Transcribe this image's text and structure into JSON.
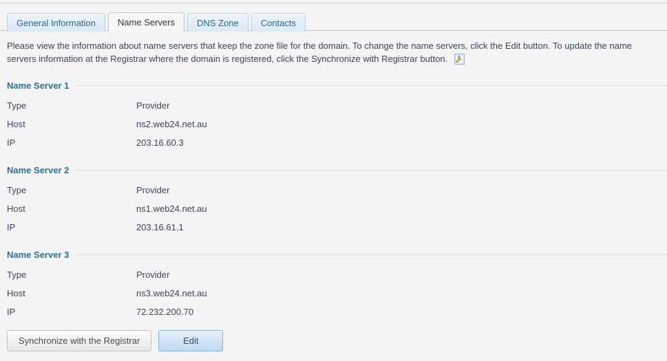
{
  "colors": {
    "page_background": "#f4f4f4",
    "tab_link": "#2167a8",
    "section_title": "#2f7094",
    "body_text": "#3c4654",
    "primary_button_border": "#7fb0d8",
    "rule": "#dedede"
  },
  "tabs": [
    {
      "label": "General Information",
      "active": false,
      "name": "tab-general-information"
    },
    {
      "label": "Name Servers",
      "active": true,
      "name": "tab-name-servers"
    },
    {
      "label": "DNS Zone",
      "active": false,
      "name": "tab-dns-zone"
    },
    {
      "label": "Contacts",
      "active": false,
      "name": "tab-contacts"
    }
  ],
  "description": {
    "text": "Please view the information about name servers that keep the zone file for the domain. To change the name servers, click the Edit button. To update the name servers information at the Registrar where the domain is registered, click the Synchronize with Registrar button.",
    "help_icon": "note-pencil-help-icon"
  },
  "sections": [
    {
      "title": "Name Server 1",
      "rows": [
        {
          "label": "Type",
          "value": "Provider"
        },
        {
          "label": "Host",
          "value": "ns2.web24.net.au"
        },
        {
          "label": "IP",
          "value": "203.16.60.3"
        }
      ]
    },
    {
      "title": "Name Server 2",
      "rows": [
        {
          "label": "Type",
          "value": "Provider"
        },
        {
          "label": "Host",
          "value": "ns1.web24.net.au"
        },
        {
          "label": "IP",
          "value": "203.16.61.1"
        }
      ]
    },
    {
      "title": "Name Server 3",
      "rows": [
        {
          "label": "Type",
          "value": "Provider"
        },
        {
          "label": "Host",
          "value": "ns3.web24.net.au"
        },
        {
          "label": "IP",
          "value": "72.232.200.70"
        }
      ]
    }
  ],
  "buttons": {
    "synchronize_label": "Synchronize with the Registrar",
    "edit_label": "Edit"
  }
}
